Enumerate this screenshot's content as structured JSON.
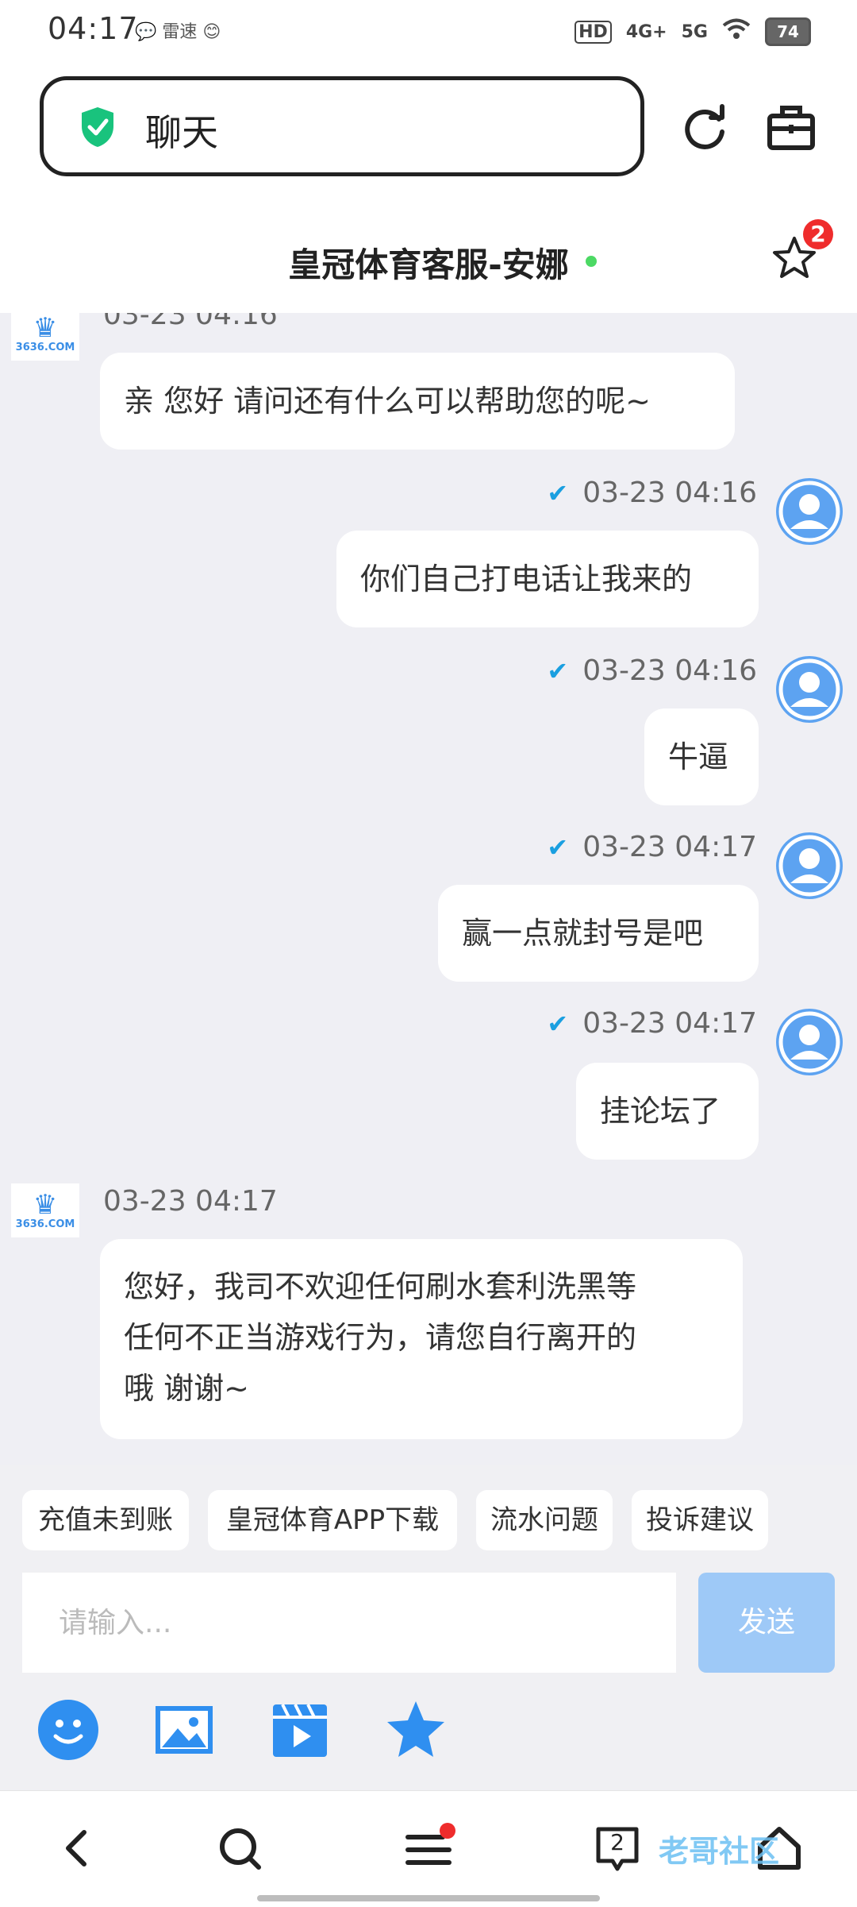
{
  "status_bar": {
    "time": "04:17",
    "left_icons": "💬 雷速 😊",
    "hd": "HD",
    "network_4g": "4G+",
    "network_5g": "5G",
    "battery": "74"
  },
  "browser": {
    "url_text": "聊天"
  },
  "chat_header": {
    "title": "皇冠体育客服-安娜",
    "star_badge": "2"
  },
  "agent_avatar": {
    "domain_text": "3636.COM"
  },
  "messages": [
    {
      "sender": "agent",
      "time": "03-23 04:16",
      "text": "亲 您好 请问还有什么可以帮助您的呢~"
    },
    {
      "sender": "user",
      "time": "03-23 04:16",
      "text": "你们自己打电话让我来的"
    },
    {
      "sender": "user",
      "time": "03-23 04:16",
      "text": "牛逼"
    },
    {
      "sender": "user",
      "time": "03-23 04:17",
      "text": "赢一点就封号是吧"
    },
    {
      "sender": "user",
      "time": "03-23 04:17",
      "text": "挂论坛了"
    },
    {
      "sender": "agent",
      "time": "03-23 04:17",
      "lines": [
        "您好，我司不欢迎任何刷水套利洗黑等",
        "任何不正当游戏行为，请您自行离开的",
        "哦 谢谢~"
      ]
    }
  ],
  "quick_replies": [
    "充值未到账",
    "皇冠体育APP下载",
    "流水问题",
    "投诉建议"
  ],
  "composer": {
    "placeholder": "请输入...",
    "send_label": "发送"
  },
  "tools": [
    "emoji-icon",
    "image-icon",
    "video-icon",
    "star-icon"
  ],
  "bottom_nav": {
    "tabs_count": "2"
  },
  "watermark": "老哥社区",
  "colors": {
    "accent": "#2f8ff0",
    "send_disabled": "#9ec9f7",
    "chat_bg": "#efeff4",
    "badge": "#ef2c2c",
    "shield": "#19c37d"
  }
}
